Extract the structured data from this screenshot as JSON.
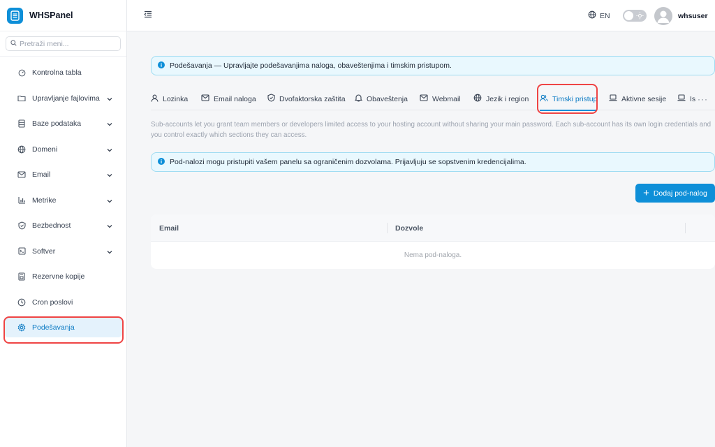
{
  "brand": {
    "name": "WHSPanel",
    "accent": "#0e8fd8"
  },
  "search": {
    "placeholder": "Pretraži meni..."
  },
  "sidebar": {
    "items": [
      {
        "label": "Kontrolna tabla",
        "icon": "dashboard-icon",
        "has_submenu": false
      },
      {
        "label": "Upravljanje fajlovima",
        "icon": "folder-icon",
        "has_submenu": true
      },
      {
        "label": "Baze podataka",
        "icon": "database-icon",
        "has_submenu": true
      },
      {
        "label": "Domeni",
        "icon": "globe-icon",
        "has_submenu": true
      },
      {
        "label": "Email",
        "icon": "mail-icon",
        "has_submenu": true
      },
      {
        "label": "Metrike",
        "icon": "bar-chart-icon",
        "has_submenu": true
      },
      {
        "label": "Bezbednost",
        "icon": "shield-icon",
        "has_submenu": true
      },
      {
        "label": "Softver",
        "icon": "terminal-icon",
        "has_submenu": true
      },
      {
        "label": "Rezervne kopije",
        "icon": "backup-icon",
        "has_submenu": false
      },
      {
        "label": "Cron poslovi",
        "icon": "clock-icon",
        "has_submenu": false
      },
      {
        "label": "Podešavanja",
        "icon": "gear-icon",
        "has_submenu": false,
        "active": true
      }
    ]
  },
  "topbar": {
    "language": "EN",
    "username": "whsuser",
    "theme": "light"
  },
  "main": {
    "info_banner": "Podešavanja — Upravljajte podešavanjima naloga, obaveštenjima i timskim pristupom.",
    "tabs": [
      {
        "label": "Lozinka",
        "icon": "user-icon"
      },
      {
        "label": "Email naloga",
        "icon": "mail-icon"
      },
      {
        "label": "Dvofaktorska zaštita",
        "icon": "shield-icon"
      },
      {
        "label": "Obaveštenja",
        "icon": "bell-icon"
      },
      {
        "label": "Webmail",
        "icon": "mail-icon"
      },
      {
        "label": "Jezik i region",
        "icon": "globe-icon"
      },
      {
        "label": "Timski pristup",
        "icon": "users-icon",
        "active": true
      },
      {
        "label": "Aktivne sesije",
        "icon": "laptop-icon"
      },
      {
        "label": "Is",
        "icon": "laptop-icon"
      }
    ],
    "more_label": "···",
    "description": "Sub-accounts let you grant team members or developers limited access to your hosting account without sharing your main password. Each sub-account has its own login credentials and you control exactly which sections they can access.",
    "subaccount_banner": "Pod-nalozi mogu pristupiti vašem panelu sa ograničenim dozvolama. Prijavljuju se sopstvenim kredencijalima.",
    "add_button": "Dodaj pod-nalog",
    "table": {
      "columns": [
        "Email",
        "Dozvole"
      ],
      "empty_text": "Nema pod-naloga."
    }
  }
}
